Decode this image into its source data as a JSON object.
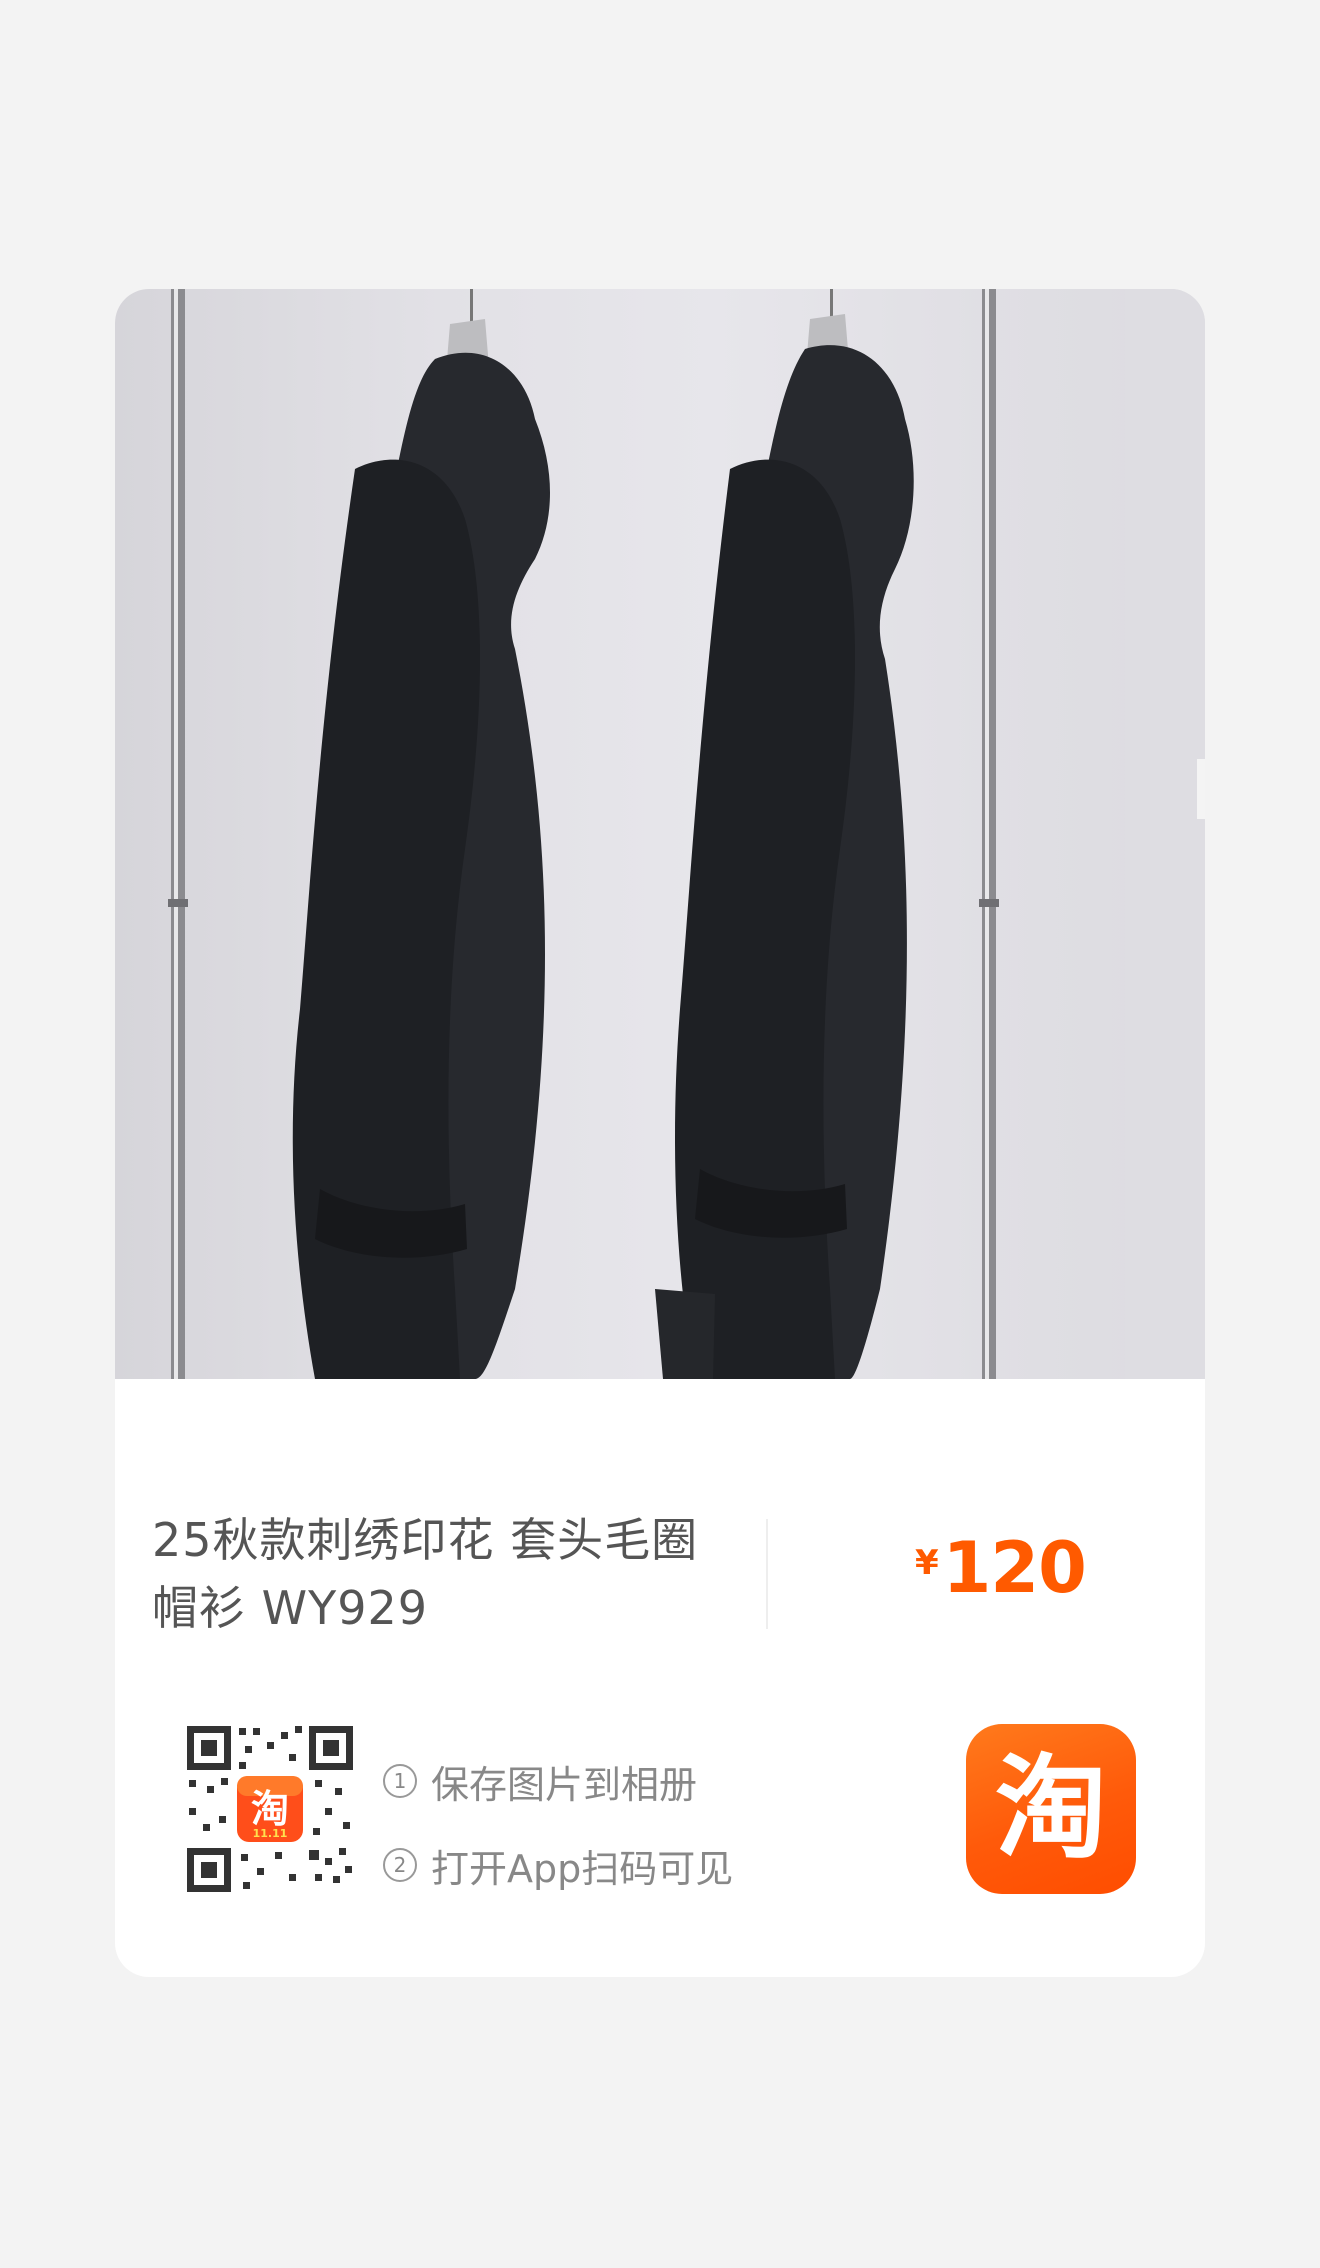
{
  "product": {
    "title_line1": "25秋款刺绣印花 套头毛圈",
    "title_line2": "帽衫 WY929",
    "currency": "¥",
    "price": "120"
  },
  "share": {
    "step1_num": "1",
    "step1": "保存图片到相册",
    "step2_num": "2",
    "step2": "打开App扫码可见",
    "qr_center_label": "淘",
    "qr_center_sub": "11.11",
    "logo_glyph": "淘"
  },
  "colors": {
    "price": "#ff5a00",
    "taobao_orange": "#ff5a0a",
    "title": "#555555",
    "hint": "#888888"
  }
}
